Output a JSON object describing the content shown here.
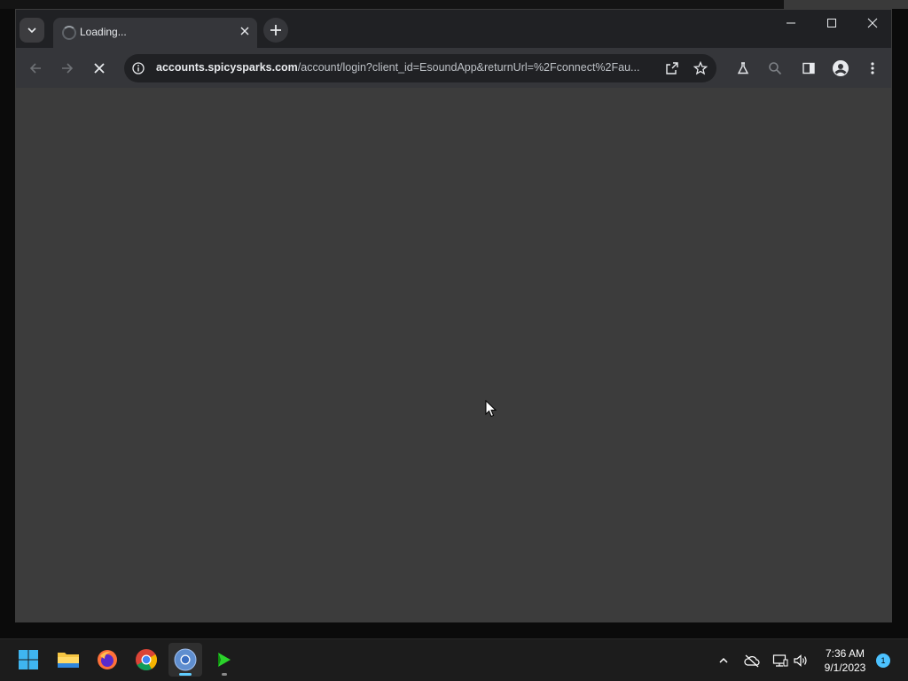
{
  "browser": {
    "tab": {
      "title": "Loading..."
    },
    "address_bar": {
      "host": "accounts.spicysparks.com",
      "path": "/account/login?client_id=EsoundApp&returnUrl=%2Fconnect%2Fau..."
    },
    "icons": {
      "tab_search": "chevron-down-icon",
      "close_tab": "close-icon",
      "new_tab": "plus-icon",
      "back": "arrow-left-icon",
      "forward": "arrow-right-icon",
      "stop": "close-icon",
      "site_info": "info-icon",
      "share": "share-icon",
      "bookmark": "star-icon",
      "labs": "flask-icon",
      "zoom": "search-icon",
      "side_panel": "side-panel-icon",
      "profile": "person-icon",
      "menu": "kebab-menu-icon"
    }
  },
  "taskbar": {
    "apps": [
      "start-icon",
      "file-explorer-icon",
      "firefox-icon",
      "chrome-icon",
      "chrome-dev-icon",
      "media-player-icon"
    ],
    "clock": {
      "time": "7:36 AM",
      "date": "9/1/2023"
    },
    "notification_count": "1"
  },
  "colors": {
    "content_bg": "#3c3c3c",
    "toolbar_bg": "#35363a",
    "taskbar_bg": "#1c1c1c",
    "accent": "#60cdff"
  }
}
